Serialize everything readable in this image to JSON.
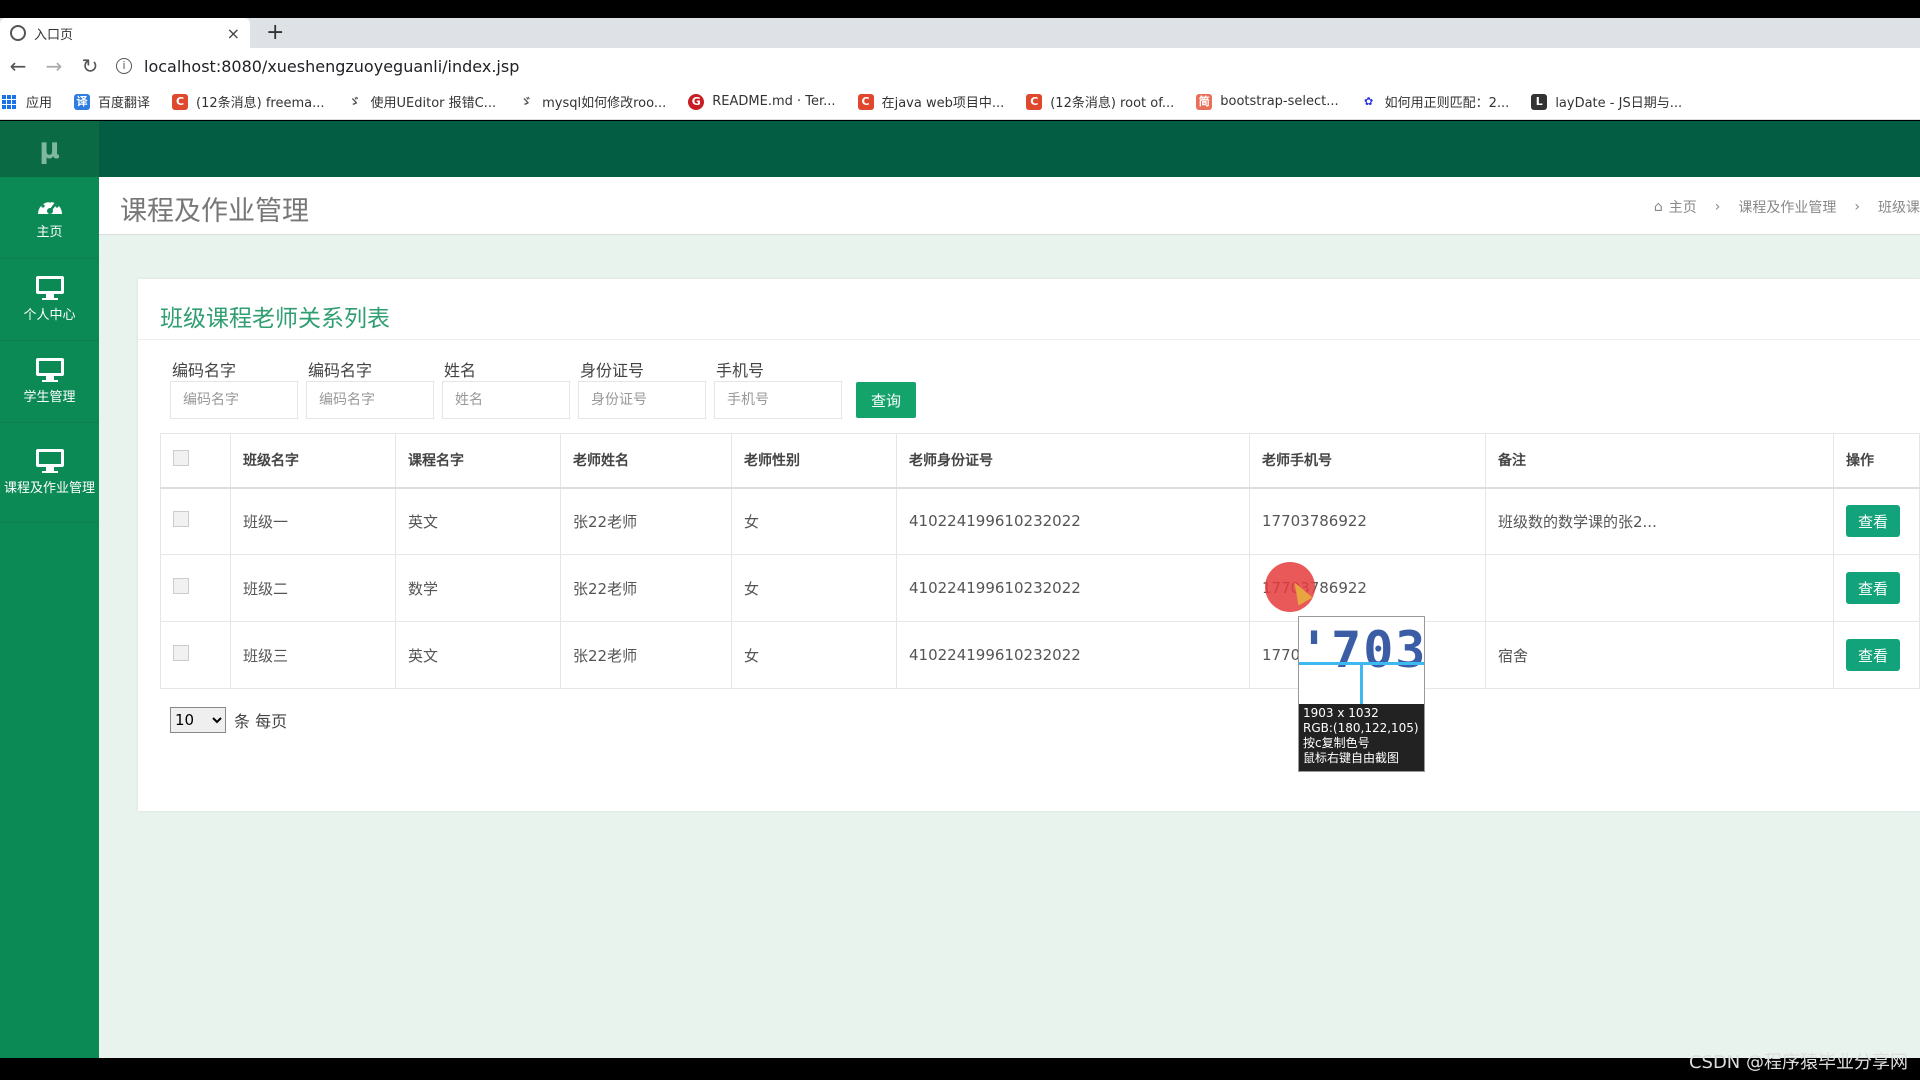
{
  "browser": {
    "tab_title": "入口页",
    "tab_close": "×",
    "new_tab": "+",
    "url": "localhost:8080/xueshengzuoyeguanli/index.jsp",
    "bookmarks": [
      {
        "label": "应用",
        "icon": "apps-grid-icon"
      },
      {
        "label": "百度翻译",
        "icon": "baidu-translate-icon",
        "color": "#2f7de1",
        "glyph": "译"
      },
      {
        "label": "(12条消息) freema...",
        "icon": "csdn-icon",
        "color": "#e0482d",
        "glyph": "C"
      },
      {
        "label": "使用UEditor 报错C...",
        "icon": "bird-icon",
        "color": "#555555",
        "glyph": "ゞ"
      },
      {
        "label": "mysql如何修改roo...",
        "icon": "bird-icon",
        "color": "#555555",
        "glyph": "ゞ"
      },
      {
        "label": "README.md · Ter...",
        "icon": "gitee-icon",
        "color": "#c71d23",
        "glyph": "G"
      },
      {
        "label": "在java web项目中...",
        "icon": "csdn-icon",
        "color": "#e0482d",
        "glyph": "C"
      },
      {
        "label": "(12条消息) root of...",
        "icon": "csdn-icon",
        "color": "#e0482d",
        "glyph": "C"
      },
      {
        "label": "bootstrap-select...",
        "icon": "jianshu-icon",
        "color": "#ea6f5a",
        "glyph": "简"
      },
      {
        "label": "如何用正则匹配：2...",
        "icon": "baidu-icon",
        "color": "#2932e1",
        "glyph": "✿"
      },
      {
        "label": "layDate - JS日期与...",
        "icon": "laydate-icon",
        "color": "#333333",
        "glyph": "L"
      }
    ]
  },
  "sidebar": {
    "logo": "μ",
    "items": [
      {
        "label": "主页",
        "icon": "dashboard-icon"
      },
      {
        "label": "个人中心",
        "icon": "monitor-icon"
      },
      {
        "label": "学生管理",
        "icon": "monitor-icon"
      },
      {
        "label": "课程及作业管理",
        "icon": "monitor-icon"
      }
    ]
  },
  "header": {
    "page_title": "课程及作业管理",
    "breadcrumb": [
      "主页",
      "课程及作业管理",
      "班级课"
    ]
  },
  "panel": {
    "title": "班级课程老师关系列表",
    "filters": [
      {
        "label": "编码名字",
        "placeholder": "编码名字"
      },
      {
        "label": "编码名字",
        "placeholder": "编码名字"
      },
      {
        "label": "姓名",
        "placeholder": "姓名"
      },
      {
        "label": "身份证号",
        "placeholder": "身份证号"
      },
      {
        "label": "手机号",
        "placeholder": "手机号"
      }
    ],
    "search_label": "查询",
    "table": {
      "headers": [
        "班级名字",
        "课程名字",
        "老师姓名",
        "老师性别",
        "老师身份证号",
        "老师手机号",
        "备注",
        "操作"
      ],
      "rows": [
        {
          "class": "班级一",
          "course": "英文",
          "teacher": "张22老师",
          "gender": "女",
          "id": "410224199610232022",
          "phone": "17703786922",
          "note": "班级数的数学课的张2...",
          "action": "查看"
        },
        {
          "class": "班级二",
          "course": "数学",
          "teacher": "张22老师",
          "gender": "女",
          "id": "410224199610232022",
          "phone": "17703786922",
          "note": "",
          "action": "查看"
        },
        {
          "class": "班级三",
          "course": "英文",
          "teacher": "张22老师",
          "gender": "女",
          "id": "410224199610232022",
          "phone": "1770",
          "note": "宿舍",
          "action": "查看"
        }
      ]
    },
    "pager": {
      "page_size": "10",
      "suffix": "条 每页"
    }
  },
  "overlay": {
    "zoom_text": "'703",
    "size": "1903 x 1032",
    "rgb": "RGB:(180,122,105)",
    "hint1": "按c复制色号",
    "hint2": "鼠标右键自由截图"
  },
  "watermark": "CSDN @程序猿毕业分享网"
}
